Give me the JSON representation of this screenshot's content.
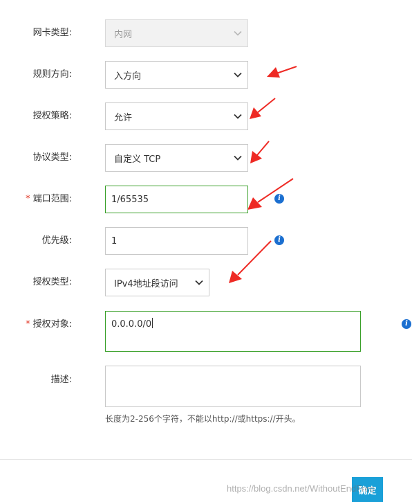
{
  "form": {
    "nic_type": {
      "label": "网卡类型:",
      "value": "内网",
      "disabled": true
    },
    "direction": {
      "label": "规则方向:",
      "value": "入方向"
    },
    "policy": {
      "label": "授权策略:",
      "value": "允许"
    },
    "protocol": {
      "label": "协议类型:",
      "value": "自定义 TCP"
    },
    "port_range": {
      "required_mark": "*",
      "label": "端口范围:",
      "value": "1/65535",
      "info_icon": "info-icon"
    },
    "priority": {
      "label": "优先级:",
      "value": "1",
      "info_icon": "info-icon"
    },
    "auth_type": {
      "label": "授权类型:",
      "value": "IPv4地址段访问"
    },
    "auth_object": {
      "required_mark": "*",
      "label": "授权对象:",
      "value": "0.0.0.0/0",
      "info_icon": "info-icon"
    },
    "description": {
      "label": "描述:",
      "value": "",
      "hint": "长度为2-256个字符，不能以http://或https://开头。"
    }
  },
  "footer": {
    "ok_label": "确定",
    "watermark": "https://blog.csdn.net/WithoutEndFree"
  },
  "colors": {
    "primary_button": "#1aa0d8",
    "focus_border": "#3aa02a",
    "required_mark": "#e0301e",
    "info_icon": "#1b6fd0",
    "annotation_arrow": "#ee2a24"
  }
}
